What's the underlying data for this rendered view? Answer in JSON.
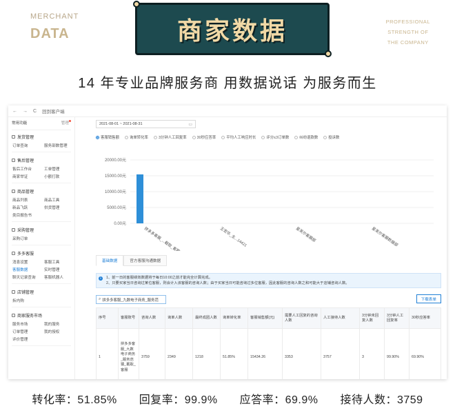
{
  "brand": {
    "left_small": "MERCHANT",
    "left_big": "DATA",
    "right_lines": [
      "PROFESSIONAL",
      "STRENGTH OF",
      "THE COMPANY"
    ],
    "banner_title": "商家数据"
  },
  "slogan": "14 年专业品牌服务商 用数据说话 为服务而生",
  "window": {
    "nav": {
      "back": "←",
      "forward": "→",
      "refresh": "C",
      "title": "回到客户端"
    },
    "sidebar": {
      "header": "常用功能",
      "manage": "管理",
      "sections": [
        {
          "title": "发货管理",
          "items": [
            "订单查询",
            "服务部数管理"
          ]
        },
        {
          "title": "售后管理",
          "items": [
            "售后工作台",
            "工单管理",
            "商家举证",
            "小额打款"
          ]
        },
        {
          "title": "商品管理",
          "items": [
            "商品列表",
            "商品工具",
            "新品飞跃",
            "供货管理",
            "类目报告书"
          ]
        },
        {
          "title": "采购管理",
          "items": [
            "采购订单"
          ]
        },
        {
          "title": "多多客服",
          "items": [
            "消息设置",
            "客服工具",
            "客服数据",
            "实时管理",
            "聊天记录查询",
            "客服机器人"
          ]
        },
        {
          "title": "店铺管理",
          "items": [
            "拆内购"
          ]
        },
        {
          "title": "商家服务市场",
          "items": [
            "服务市场",
            "我的服务",
            "订单管理",
            "我的授权",
            "评价管理"
          ]
        }
      ]
    },
    "date_range": "2021-08-01 ~ 2021-08-31",
    "metrics": [
      "客服销售额",
      "询单转化率",
      "3分钟人工回复率",
      "30秒应答率",
      "平均人工响应时长",
      "评分≤3订单数",
      "纠纷退款数",
      "投诉数"
    ],
    "tabs": [
      "基础数据",
      "官方客服沟通数据"
    ],
    "notice": [
      "1、前一日的客服绩效数据将于每日10:00之前才能完全计算完成。",
      "2、只要买家当日咨询过某位客服，则会计入该客服的咨询人数；由于买家当日可能咨询过多位客服，因此客服的咨询人数之和可能大于店铺咨询人数。"
    ],
    "search_value": "拼多多客服_九数电子商务_服务范",
    "download_button": "下载表单",
    "table": {
      "headers": [
        "序号",
        "客服账号",
        "咨询人数",
        "询单人数",
        "最终成团人数",
        "询单转化率",
        "客服销售额(元)",
        "需要人工回复的咨询人数",
        "人工接待人数",
        "3分钟未回复人数",
        "3分钟人工回复率",
        "30秒应答率"
      ],
      "rows": [
        [
          "1",
          "拼多多客服_九数电子商务_服务范猿_截取_客服",
          "3759",
          "2349",
          "1218",
          "51.85%",
          "15434.26",
          "3353",
          "3757",
          "3",
          "99.90%",
          "69.90%"
        ]
      ]
    }
  },
  "stats": [
    "转化率：51.85%",
    "回复率：99.9%",
    "应答率：69.9%",
    "接待人数：3759"
  ],
  "chart_data": {
    "type": "bar",
    "categories": [
      "拼多多客服_...截取_客服",
      "王宏华_主...14421",
      "星芙尔客服部",
      "星芙尔客服数据部"
    ],
    "values": [
      15434.26,
      0,
      0,
      0
    ],
    "ylim": [
      0,
      20000
    ],
    "yticks": [
      "20000.00元",
      "15000.00元",
      "10000.00元",
      "5000.00元",
      "0.00元"
    ],
    "selected_metric": "客服销售额",
    "colors": {
      "bar": "#2e8fd8",
      "accent": "#1f7fd6",
      "banner": "#1d4a4f",
      "banner_text": "#f1d9a6"
    }
  }
}
